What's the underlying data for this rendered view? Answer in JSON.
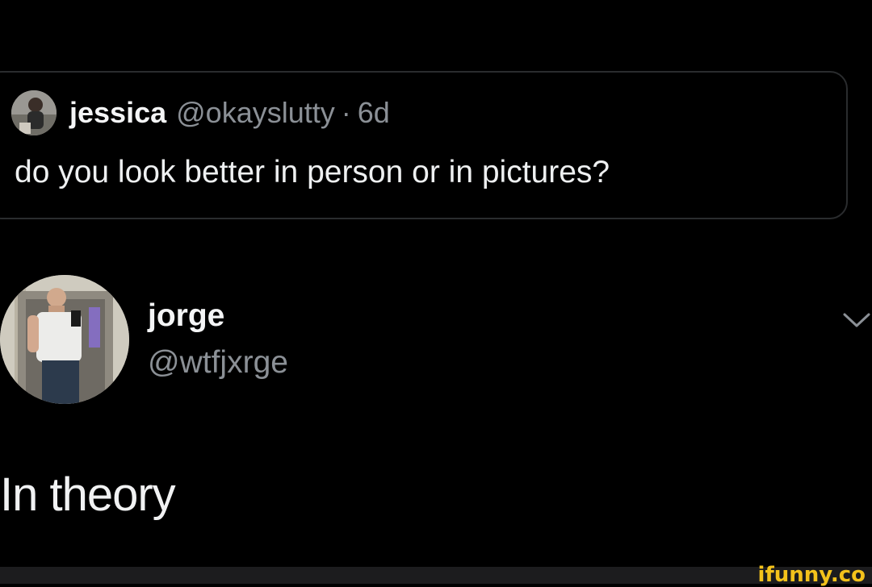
{
  "quoted_tweet": {
    "name": "jessica",
    "handle": "@okayslutty",
    "separator": "·",
    "time": "6d",
    "text": "do you look better in person or in pictures?"
  },
  "reply_tweet": {
    "name": "jorge",
    "handle": "@wtfjxrge",
    "text": "In theory",
    "menu_icon": "chevron-down-icon"
  },
  "watermark": "ifunny.co",
  "colors": {
    "background": "#000000",
    "primary_text": "#e7e9ea",
    "secondary_text": "#8b9096",
    "card_border": "#2a2c2e",
    "watermark": "#f3c21b"
  }
}
